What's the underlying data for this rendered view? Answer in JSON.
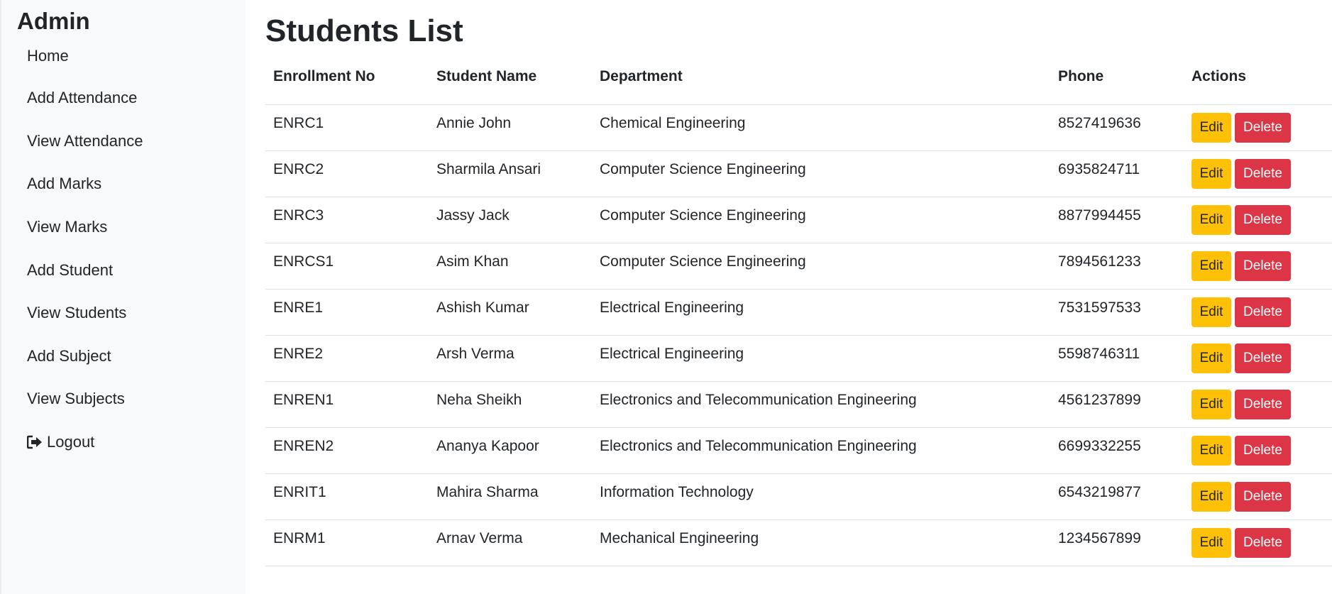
{
  "sidebar": {
    "title": "Admin",
    "items": [
      {
        "label": "Home"
      },
      {
        "label": "Add Attendance"
      },
      {
        "label": "View Attendance"
      },
      {
        "label": "Add Marks"
      },
      {
        "label": "View Marks"
      },
      {
        "label": "Add Student"
      },
      {
        "label": "View Students"
      },
      {
        "label": "Add Subject"
      },
      {
        "label": "View Subjects"
      }
    ],
    "logout": {
      "label": "Logout",
      "icon": "logout-icon"
    }
  },
  "main": {
    "title": "Students List",
    "table": {
      "headers": {
        "enrollment": "Enrollment No",
        "name": "Student Name",
        "department": "Department",
        "phone": "Phone",
        "actions": "Actions"
      },
      "edit_label": "Edit",
      "delete_label": "Delete",
      "rows": [
        {
          "enrollment": "ENRC1",
          "name": "Annie John",
          "department": "Chemical Engineering",
          "phone": "8527419636"
        },
        {
          "enrollment": "ENRC2",
          "name": "Sharmila Ansari",
          "department": "Computer Science Engineering",
          "phone": "6935824711"
        },
        {
          "enrollment": "ENRC3",
          "name": "Jassy Jack",
          "department": "Computer Science Engineering",
          "phone": "8877994455"
        },
        {
          "enrollment": "ENRCS1",
          "name": "Asim Khan",
          "department": "Computer Science Engineering",
          "phone": "7894561233"
        },
        {
          "enrollment": "ENRE1",
          "name": "Ashish Kumar",
          "department": "Electrical Engineering",
          "phone": "7531597533"
        },
        {
          "enrollment": "ENRE2",
          "name": "Arsh Verma",
          "department": "Electrical Engineering",
          "phone": "5598746311"
        },
        {
          "enrollment": "ENREN1",
          "name": "Neha Sheikh",
          "department": "Electronics and Telecommunication Engineering",
          "phone": "4561237899"
        },
        {
          "enrollment": "ENREN2",
          "name": "Ananya Kapoor",
          "department": "Electronics and Telecommunication Engineering",
          "phone": "6699332255"
        },
        {
          "enrollment": "ENRIT1",
          "name": "Mahira Sharma",
          "department": "Information Technology",
          "phone": "6543219877"
        },
        {
          "enrollment": "ENRM1",
          "name": "Arnav Verma",
          "department": "Mechanical Engineering",
          "phone": "1234567899"
        }
      ]
    }
  },
  "colors": {
    "sidebar_bg": "#f8f9fa",
    "edit_button": "#ffc107",
    "delete_button": "#dc3545",
    "row_border": "#dee2e6"
  }
}
